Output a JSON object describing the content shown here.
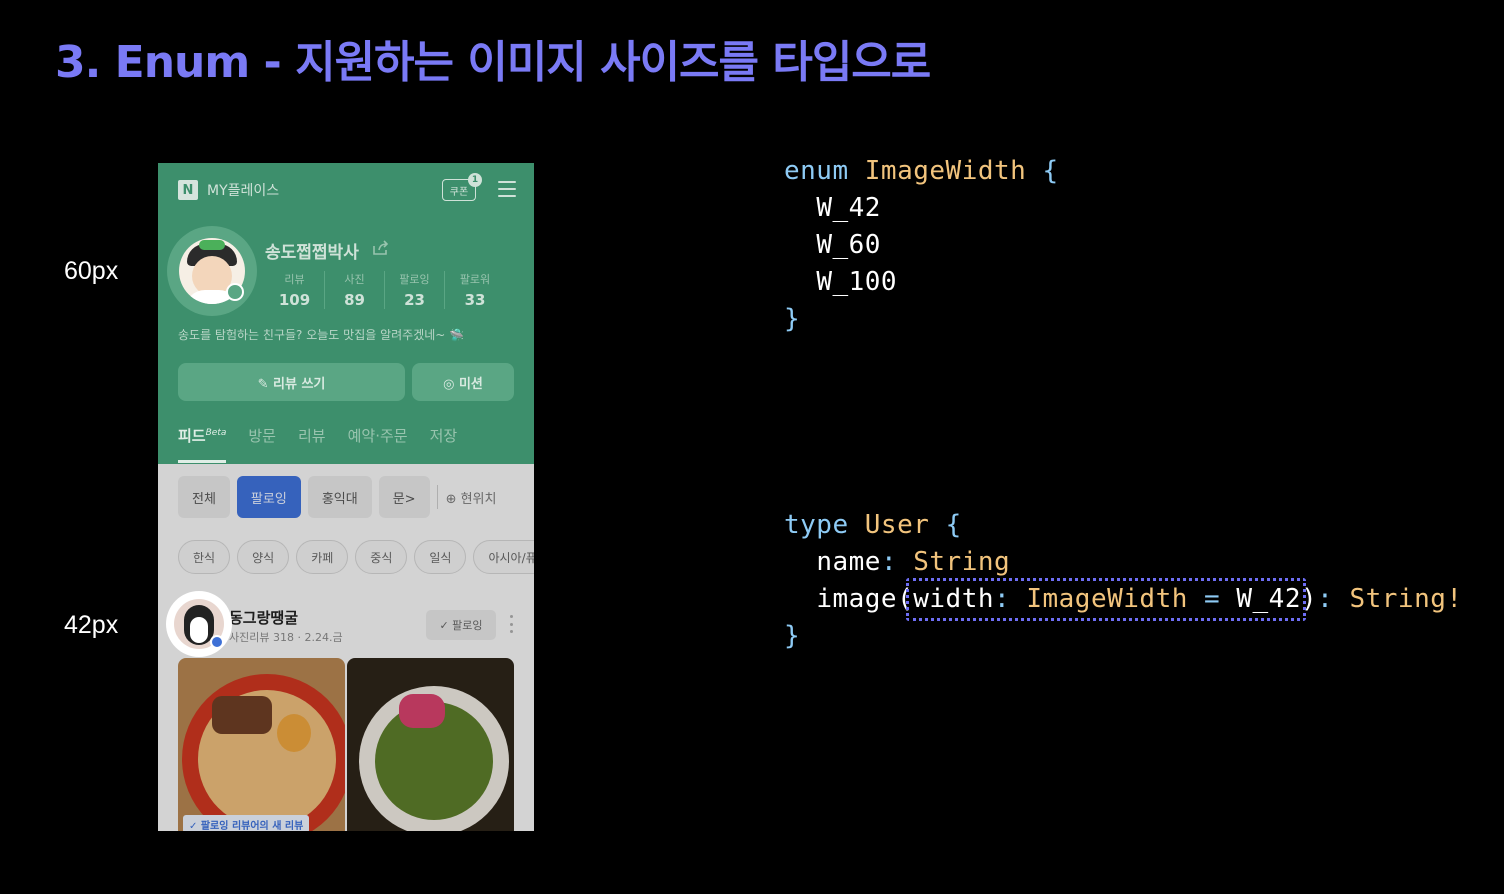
{
  "slide": {
    "title": "3. Enum - 지원하는 이미지 사이즈를 타입으로"
  },
  "size_labels": {
    "large": "60px",
    "small": "42px"
  },
  "phone": {
    "logo": "N",
    "brand": "MY플레이스",
    "coupon_label": "쿠폰",
    "coupon_count": "1",
    "profile": {
      "username": "송도쩝쩝박사",
      "stats": [
        {
          "label": "리뷰",
          "value": "109"
        },
        {
          "label": "사진",
          "value": "89"
        },
        {
          "label": "팔로잉",
          "value": "23"
        },
        {
          "label": "팔로워",
          "value": "33"
        }
      ],
      "bio": "송도를 탐험하는 친구들? 오늘도 맛집을 알려주겠네~ 🛸"
    },
    "buttons": {
      "review": "✎ 리뷰 쓰기",
      "mission": "◎ 미션"
    },
    "tabs": [
      {
        "label": "피드",
        "sup": "Beta"
      },
      {
        "label": "방문"
      },
      {
        "label": "리뷰"
      },
      {
        "label": "예약·주문"
      },
      {
        "label": "저장"
      }
    ],
    "filters": [
      "전체",
      "팔로잉",
      "홍익대",
      "문>"
    ],
    "location": "⊕ 현위치",
    "categories": [
      "한식",
      "양식",
      "카페",
      "중식",
      "일식",
      "아시아/퓨"
    ],
    "post": {
      "author": "동그랑땡굴",
      "meta": "사진리뷰 318 · 2.24.금",
      "follow_label": "✓ 팔로잉",
      "new_badge": "✓ 팔로잉 리뷰어의 새 리뷰"
    }
  },
  "code": {
    "enum_block": {
      "keyword": "enum",
      "name": "ImageWidth",
      "values": [
        "W_42",
        "W_60",
        "W_100"
      ]
    },
    "type_block": {
      "keyword": "type",
      "name": "User",
      "field1_name": "name",
      "field1_type": "String",
      "field2_name": "image",
      "arg_name": "width",
      "arg_type": "ImageWidth",
      "arg_default": "W_42",
      "field2_type": "String!"
    }
  },
  "colors": {
    "title": "#7a7af5",
    "keyword": "#8ecbf5",
    "type": "#f2c47d",
    "highlight": "#6e6ef5",
    "phone_green": "#3d8f6c"
  }
}
